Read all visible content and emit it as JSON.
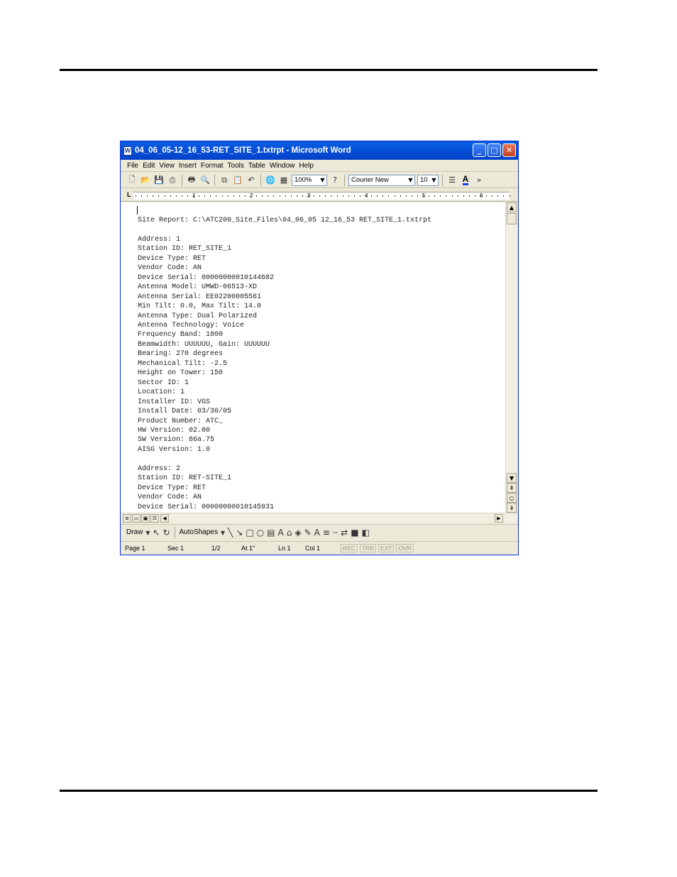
{
  "window": {
    "title": "04_06_05-12_16_53-RET_SITE_1.txtrpt - Microsoft Word",
    "app_icon": "W",
    "controls": {
      "minimize": "_",
      "maximize": "□",
      "close": "✕"
    }
  },
  "menu": [
    "File",
    "Edit",
    "View",
    "Insert",
    "Format",
    "Tools",
    "Table",
    "Window",
    "Help"
  ],
  "toolbar": {
    "zoom": "100%",
    "font_name": "Courier New",
    "font_size": "10",
    "font_color_label": "A"
  },
  "ruler": {
    "tab_marker": "L",
    "numbers": [
      "1",
      "2",
      "3",
      "4",
      "5",
      "6"
    ]
  },
  "document": {
    "lines": [
      "Site Report: C:\\ATC200_Site_Files\\04_06_05 12_16_53 RET_SITE_1.txtrpt",
      "",
      "Address: 1",
      "Station ID: RET_SITE_1",
      "Device Type: RET",
      "Vendor Code: AN",
      "Device Serial: 00000000010144682",
      "Antenna Model: UMWD-06513-XD",
      "Antenna Serial: EE02200005561",
      "Min Tilt: 0.0, Max Tilt: 14.0",
      "Antenna Type: Dual Polarized",
      "Antenna Technology: Voice",
      "Frequency Band: 1800",
      "Beamwidth: UUUUUU, Gain: UUUUUU",
      "Bearing: 270 degrees",
      "Mechanical Tilt: -2.5",
      "Height on Tower: 150",
      "Sector ID: 1",
      "Location: 1",
      "Installer ID: VGS",
      "Install Date: 03/30/05",
      "Product Number: ATC_",
      "HW Version: 02.00",
      "SW Version: 86a.75",
      "AISG Version: 1.0",
      "",
      "Address: 2",
      "Station ID: RET-SITE_1",
      "Device Type: RET",
      "Vendor Code: AN",
      "Device Serial: 00000000010145931"
    ]
  },
  "drawbar": {
    "draw_label": "Draw",
    "autoshapes_label": "AutoShapes"
  },
  "status": {
    "page": "Page 1",
    "sec": "Sec 1",
    "pages": "1/2",
    "at": "At 1\"",
    "ln": "Ln 1",
    "col": "Col 1",
    "rec": "REC",
    "trk": "TRK",
    "ext": "EXT",
    "ovr": "OVR"
  }
}
